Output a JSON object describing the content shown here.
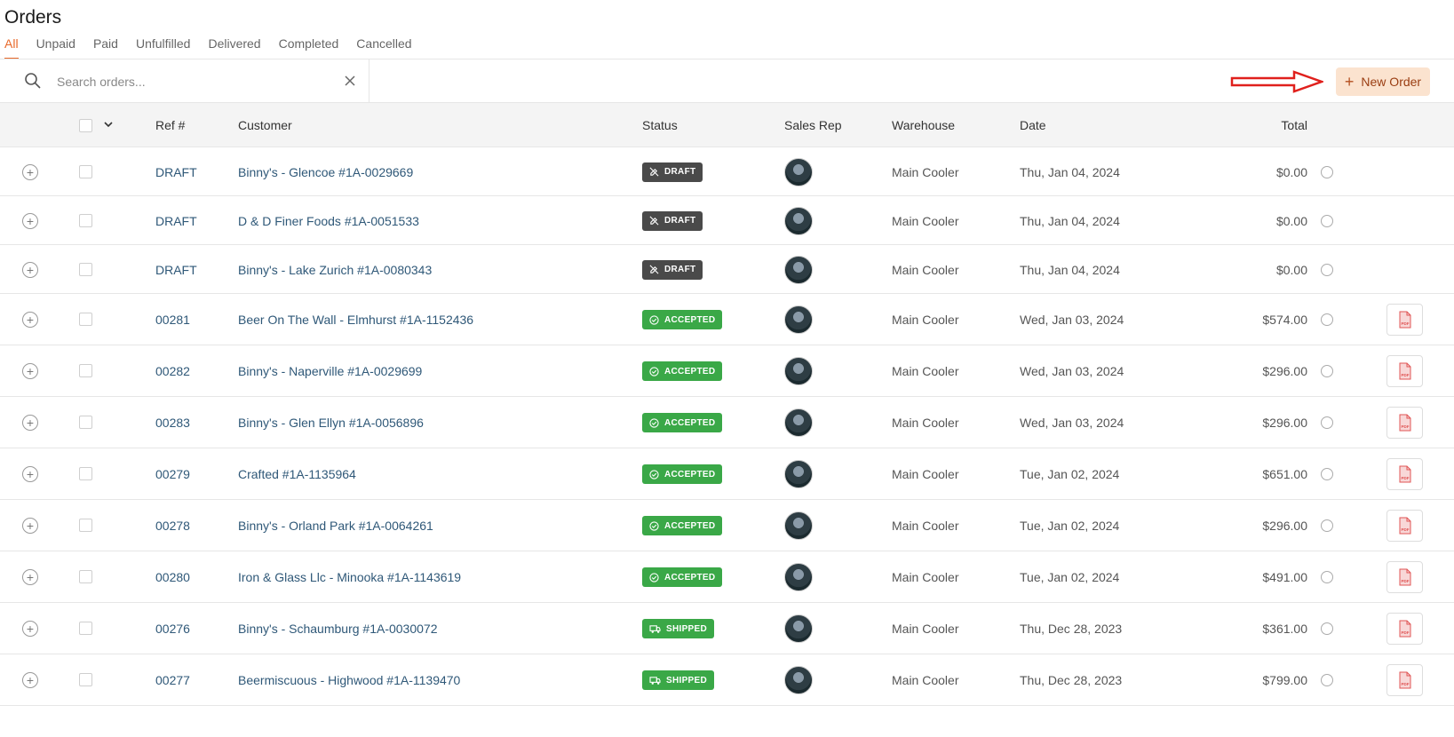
{
  "page_title": "Orders",
  "tabs": [
    {
      "label": "All",
      "active": true
    },
    {
      "label": "Unpaid"
    },
    {
      "label": "Paid"
    },
    {
      "label": "Unfulfilled"
    },
    {
      "label": "Delivered"
    },
    {
      "label": "Completed"
    },
    {
      "label": "Cancelled"
    }
  ],
  "search": {
    "placeholder": "Search orders...",
    "value": ""
  },
  "new_order_label": "New Order",
  "columns": {
    "ref": "Ref #",
    "customer": "Customer",
    "status": "Status",
    "sales_rep": "Sales Rep",
    "warehouse": "Warehouse",
    "date": "Date",
    "total": "Total"
  },
  "colors": {
    "accent": "#e8692a",
    "draft": "#4a4a4a",
    "accepted": "#3aa847",
    "link": "#2f5878",
    "annotation_arrow": "#e0201c"
  },
  "rows": [
    {
      "ref": "DRAFT",
      "customer": "Binny's - Glencoe #1A-0029669",
      "status": "DRAFT",
      "status_type": "draft",
      "status_icon": "pencil-off-icon",
      "warehouse": "Main Cooler",
      "date": "Thu, Jan 04, 2024",
      "total": "$0.00",
      "pdf": false
    },
    {
      "ref": "DRAFT",
      "customer": "D & D Finer Foods #1A-0051533",
      "status": "DRAFT",
      "status_type": "draft",
      "status_icon": "pencil-off-icon",
      "warehouse": "Main Cooler",
      "date": "Thu, Jan 04, 2024",
      "total": "$0.00",
      "pdf": false
    },
    {
      "ref": "DRAFT",
      "customer": "Binny's - Lake Zurich #1A-0080343",
      "status": "DRAFT",
      "status_type": "draft",
      "status_icon": "pencil-off-icon",
      "warehouse": "Main Cooler",
      "date": "Thu, Jan 04, 2024",
      "total": "$0.00",
      "pdf": false
    },
    {
      "ref": "00281",
      "customer": "Beer On The Wall - Elmhurst #1A-1152436",
      "status": "ACCEPTED",
      "status_type": "accepted",
      "status_icon": "check-circle-icon",
      "warehouse": "Main Cooler",
      "date": "Wed, Jan 03, 2024",
      "total": "$574.00",
      "pdf": true
    },
    {
      "ref": "00282",
      "customer": "Binny's - Naperville #1A-0029699",
      "status": "ACCEPTED",
      "status_type": "accepted",
      "status_icon": "check-circle-icon",
      "warehouse": "Main Cooler",
      "date": "Wed, Jan 03, 2024",
      "total": "$296.00",
      "pdf": true
    },
    {
      "ref": "00283",
      "customer": "Binny's - Glen Ellyn #1A-0056896",
      "status": "ACCEPTED",
      "status_type": "accepted",
      "status_icon": "check-circle-icon",
      "warehouse": "Main Cooler",
      "date": "Wed, Jan 03, 2024",
      "total": "$296.00",
      "pdf": true
    },
    {
      "ref": "00279",
      "customer": "Crafted #1A-1135964",
      "status": "ACCEPTED",
      "status_type": "accepted",
      "status_icon": "check-circle-icon",
      "warehouse": "Main Cooler",
      "date": "Tue, Jan 02, 2024",
      "total": "$651.00",
      "pdf": true
    },
    {
      "ref": "00278",
      "customer": "Binny's - Orland Park #1A-0064261",
      "status": "ACCEPTED",
      "status_type": "accepted",
      "status_icon": "check-circle-icon",
      "warehouse": "Main Cooler",
      "date": "Tue, Jan 02, 2024",
      "total": "$296.00",
      "pdf": true
    },
    {
      "ref": "00280",
      "customer": "Iron & Glass Llc - Minooka #1A-1143619",
      "status": "ACCEPTED",
      "status_type": "accepted",
      "status_icon": "check-circle-icon",
      "warehouse": "Main Cooler",
      "date": "Tue, Jan 02, 2024",
      "total": "$491.00",
      "pdf": true
    },
    {
      "ref": "00276",
      "customer": "Binny's - Schaumburg #1A-0030072",
      "status": "SHIPPED",
      "status_type": "shipped",
      "status_icon": "truck-icon",
      "warehouse": "Main Cooler",
      "date": "Thu, Dec 28, 2023",
      "total": "$361.00",
      "pdf": true
    },
    {
      "ref": "00277",
      "customer": "Beermiscuous - Highwood #1A-1139470",
      "status": "SHIPPED",
      "status_type": "shipped",
      "status_icon": "truck-icon",
      "warehouse": "Main Cooler",
      "date": "Thu, Dec 28, 2023",
      "total": "$799.00",
      "pdf": true
    }
  ]
}
